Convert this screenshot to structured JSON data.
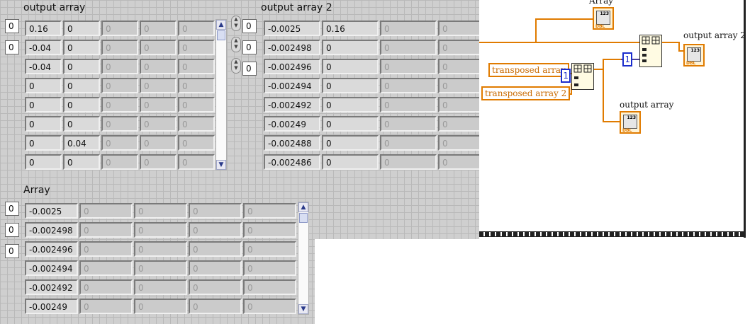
{
  "front_panel": {
    "output_array": {
      "label": "output array",
      "indices": [
        "0",
        "0"
      ],
      "rows": [
        [
          "0.16",
          "0",
          "0",
          "0",
          "0"
        ],
        [
          "-0.04",
          "0",
          "0",
          "0",
          "0"
        ],
        [
          "-0.04",
          "0",
          "0",
          "0",
          "0"
        ],
        [
          "0",
          "0",
          "0",
          "0",
          "0"
        ],
        [
          "0",
          "0",
          "0",
          "0",
          "0"
        ],
        [
          "0",
          "0",
          "0",
          "0",
          "0"
        ],
        [
          "0",
          "0.04",
          "0",
          "0",
          "0"
        ],
        [
          "0",
          "0",
          "0",
          "0",
          "0"
        ]
      ]
    },
    "output_array_2": {
      "label": "output array 2",
      "indices": [
        "0",
        "0",
        "0"
      ],
      "rows": [
        [
          "-0.0025",
          "0.16",
          "0",
          "0"
        ],
        [
          "-0.002498",
          "0",
          "0",
          "0"
        ],
        [
          "-0.002496",
          "0",
          "0",
          "0"
        ],
        [
          "-0.002494",
          "0",
          "0",
          "0"
        ],
        [
          "-0.002492",
          "0",
          "0",
          "0"
        ],
        [
          "-0.00249",
          "0",
          "0",
          "0"
        ],
        [
          "-0.002488",
          "0",
          "0",
          "0"
        ],
        [
          "-0.002486",
          "0",
          "0",
          "0"
        ]
      ]
    },
    "array": {
      "label": "Array",
      "indices": [
        "0",
        "0",
        "0"
      ],
      "rows": [
        [
          "-0.0025",
          "0",
          "0",
          "0",
          "0"
        ],
        [
          "-0.002498",
          "0",
          "0",
          "0",
          "0"
        ],
        [
          "-0.002496",
          "0",
          "0",
          "0",
          "0"
        ],
        [
          "-0.002494",
          "0",
          "0",
          "0",
          "0"
        ],
        [
          "-0.002492",
          "0",
          "0",
          "0",
          "0"
        ],
        [
          "-0.00249",
          "0",
          "0",
          "0",
          "0"
        ]
      ]
    }
  },
  "block_diagram": {
    "array_label": "Array",
    "output_array_2_label": "output array 2",
    "output_array_label": "output array",
    "transposed_array_label": "transposed array",
    "transposed_array_2_label": "transposed array 2",
    "constant_1": "1",
    "constant_2": "1",
    "terminal_type": "DBL",
    "terminal_glyph": "123",
    "wire_color": "#e07b00",
    "constant_color": "#1a2ccc"
  }
}
